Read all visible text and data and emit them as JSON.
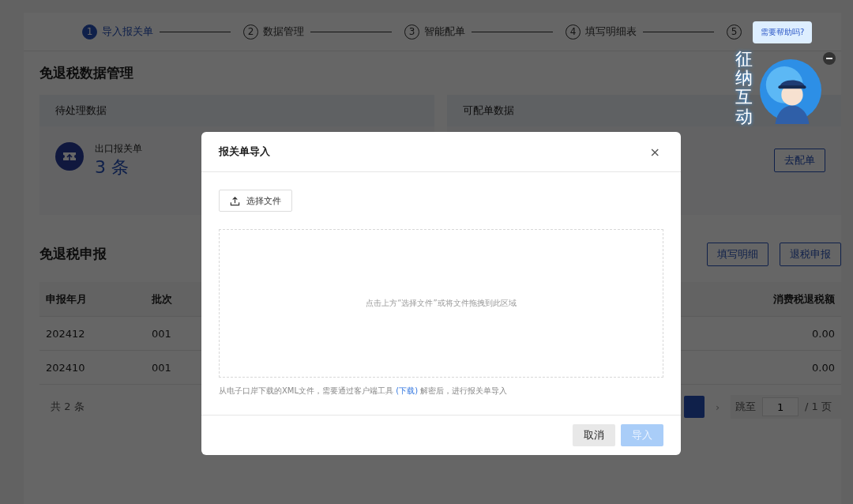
{
  "steps": [
    {
      "number": "1",
      "label": "导入报关单",
      "selected": true
    },
    {
      "number": "2",
      "label": "数据管理",
      "selected": false
    },
    {
      "number": "3",
      "label": "智能配单",
      "selected": false
    },
    {
      "number": "4",
      "label": "填写明细表",
      "selected": false
    },
    {
      "number": "5",
      "selected": false
    }
  ],
  "help_bubble": "需要帮助吗?",
  "mascot": {
    "title": "征纳互动"
  },
  "page_title": "免退税数据管理",
  "panels": [
    {
      "title": "待处理数据",
      "item": {
        "label": "出口报关单",
        "count": "3 条"
      }
    },
    {
      "title": "可配单数据",
      "button": "去配单"
    }
  ],
  "declaration": {
    "title": "免退税申报",
    "buttons": [
      "填写明细",
      "退税申报"
    ],
    "table": {
      "columns": [
        {
          "label": "申报年月"
        },
        {
          "label": "批次"
        },
        {
          "label": "消费税退税额"
        }
      ],
      "rows": [
        [
          "202412",
          "001",
          "0.00"
        ],
        [
          "202410",
          "001",
          "0.00"
        ]
      ]
    },
    "pagination": {
      "total": "共 2 条",
      "next": "›",
      "jump_label": "跳至",
      "page_value": "1",
      "page_total": "/ 1 页"
    }
  },
  "dialog": {
    "title": "报关单导入",
    "close": "×",
    "select_button": "选择文件",
    "drop_hint": "点击上方“选择文件”或将文件拖拽到此区域",
    "note_before": "从电子口岸下载的XML文件，需要通过客户端工具",
    "note_link": "(下载)",
    "note_after": "解密后，进行报关单导入",
    "cancel": "取消",
    "confirm": {
      "label": "导入",
      "disabled": true
    }
  }
}
